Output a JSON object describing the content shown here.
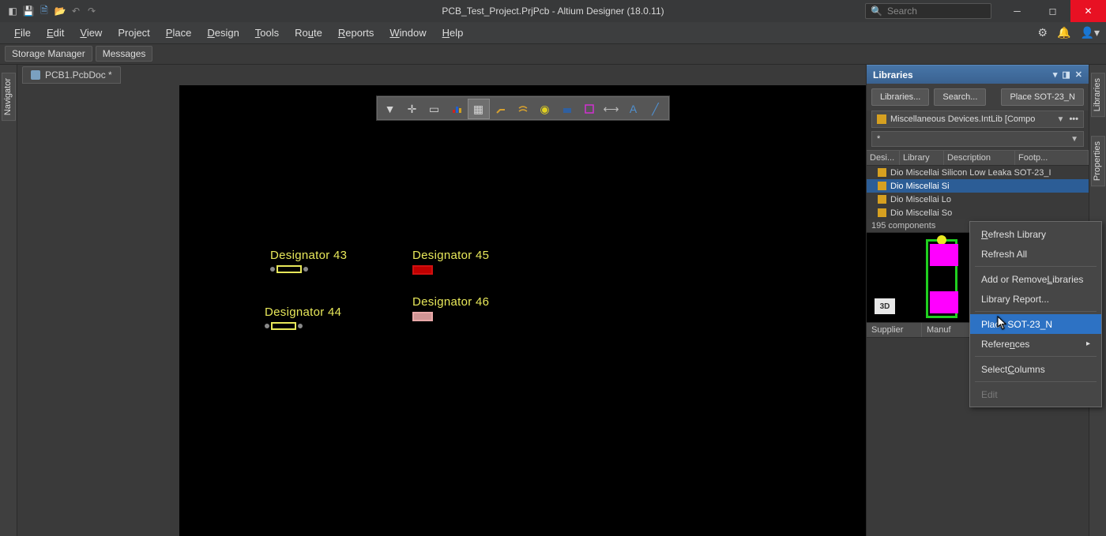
{
  "title": "PCB_Test_Project.PrjPcb - Altium Designer (18.0.11)",
  "search_placeholder": "Search",
  "menu": {
    "file": "File",
    "edit": "Edit",
    "view": "View",
    "project": "Project",
    "place": "Place",
    "design": "Design",
    "tools": "Tools",
    "route": "Route",
    "reports": "Reports",
    "window": "Window",
    "help": "Help"
  },
  "subtabs": {
    "storage": "Storage Manager",
    "messages": "Messages"
  },
  "doctab": "PCB1.PcbDoc *",
  "vtab_left": "Navigator",
  "vtab_right_top": "Libraries",
  "vtab_right_bot": "Properties",
  "components": {
    "d43": "Designator 43",
    "d44": "Designator 44",
    "d45": "Designator 45",
    "d46": "Designator 46"
  },
  "libraries": {
    "header": "Libraries",
    "btn_lib": "Libraries...",
    "btn_search": "Search...",
    "btn_place": "Place SOT-23_N",
    "selected_lib": "Miscellaneous Devices.IntLib [Compo",
    "filter_value": "*",
    "cols": {
      "c1": "Desi...",
      "c2": "Library",
      "c3": "Description",
      "c4": "Footp..."
    },
    "rows": [
      "Dio Miscellai Silicon Low Leaka SOT-23_I",
      "Dio Miscellai Si",
      "Dio Miscellai Lo",
      "Dio Miscellai So"
    ],
    "count": "195 components",
    "btn_3d": "3D",
    "suppl_cols": {
      "c1": "Supplier",
      "c2": "Manuf"
    }
  },
  "context_menu": {
    "refresh": "Refresh Library",
    "refresh_all": "Refresh All",
    "add_remove": "Add or Remove Libraries",
    "report": "Library Report...",
    "place": "Place SOT-23_N",
    "references": "References",
    "columns": "Select Columns",
    "edit": "Edit"
  }
}
